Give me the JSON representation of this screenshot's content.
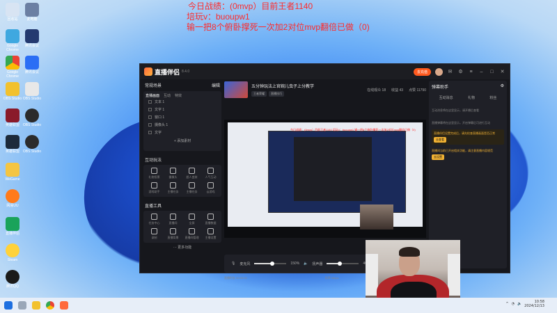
{
  "overlay": {
    "line1": "今日战绩：(0mvp）目前王者1140",
    "line2": "培玩v：buoupw1",
    "line3": "输一把8个俯卧撑死一次加2对位mvp翻倍已做（0)"
  },
  "colors": {
    "overlay_red": "#ff2a2a",
    "accent_orange": "#ff5a1f",
    "app_bg": "#16171c"
  },
  "app": {
    "name": "直播伴侣",
    "version": "8.4.0",
    "recharge_label": "去充值",
    "left": {
      "scene_title": "常规场景",
      "edit_label": "编辑",
      "tabs": [
        "直播画面",
        "互动",
        "特效"
      ],
      "sources": [
        "文本 1",
        "文字 1",
        "窗口 1",
        "摄像头 1",
        "文字"
      ],
      "add_source_label": "+ 添加素材",
      "tools_title": "互动玩法",
      "tools": [
        "礼物投票",
        "摄像头",
        "超人变装",
        "人气互动",
        "游戏助手",
        "主播任务",
        "主播任务",
        "云游戏"
      ],
      "workshop_title": "直播工具",
      "workshop": [
        "任务中心",
        "直播间",
        "全屏",
        "直播数据",
        "录制",
        "直播背景",
        "直播间管理",
        "主播设置"
      ],
      "more_label": "··· 更多功能"
    },
    "stream": {
      "title": "五分钟玩法上官婉儿虫子上分教学",
      "tags": [
        "王者荣耀",
        "直播技巧"
      ],
      "stats": [
        "在线观众 18",
        "收益 43",
        "点赞 11790"
      ]
    },
    "preview_text": "今日战绩：(0mvp）目前王者1140 培玩v：buoupw1 输一把8个俯卧撑死一次加2对位mvp翻倍已做（0)",
    "audio": {
      "mic_label": "麦克风",
      "mic_percent": "150%",
      "mic_level": 0.55,
      "speaker_label": "扬声器",
      "speaker_percent": "40%",
      "speaker_level": 0.4
    },
    "status": {
      "left": "直播时长 00:00:00",
      "center": "码率 0kbps",
      "right": "FPS 30"
    },
    "right": {
      "title": "弹幕助手",
      "tabs": [
        "互动消息",
        "礼物",
        "粉丝"
      ],
      "msg1": "互动消息将在这里显示，请开播后查看",
      "msg2": "直播弹幕将在这里显示，开启弹幕后可进行互动",
      "notice": "直播伴侣设置完成后，请先检查直播画面是否正常",
      "notice_btn": "去查看",
      "warning": "直播间当前已开启相关功能，请注意直播内容规范",
      "warning_btn": "去设置"
    }
  },
  "desktop_icons": [
    "回收站",
    "此电脑",
    "Google Chrome",
    "腾讯会议",
    "OBS Studio",
    "英雄联盟",
    "WeGame",
    "网易UU",
    "腾讯QQ",
    "直播伴侣",
    "Steam",
    "剪映"
  ],
  "taskbar": {
    "time": "10:58",
    "date": "2024/12/13"
  }
}
